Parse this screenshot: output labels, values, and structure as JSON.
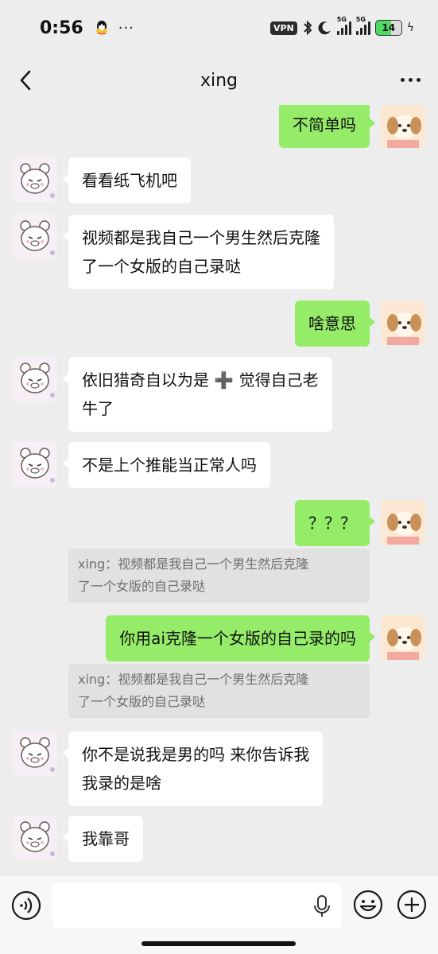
{
  "status_bar": {
    "time": "0:56",
    "more": "···",
    "vpn": "VPN",
    "sim1": "5G",
    "sim2": "5G",
    "battery": "14",
    "battery_color": "#4cd964"
  },
  "header": {
    "title": "xing"
  },
  "colors": {
    "outgoing_bubble": "#95ec69",
    "incoming_bubble": "#ffffff",
    "background": "#ededed"
  },
  "messages": [
    {
      "side": "out",
      "text": "不简单吗"
    },
    {
      "side": "in",
      "text": "看看纸飞机吧"
    },
    {
      "side": "in",
      "text": "视频都是我自己一个男生然后克隆\n了一个女版的自己录哒"
    },
    {
      "side": "out",
      "text": "啥意思"
    },
    {
      "side": "in",
      "text": "依旧猎奇自以为是 ➕ 觉得自己老\n牛了"
    },
    {
      "side": "in",
      "text": "不是上个推能当正常人吗"
    },
    {
      "side": "out",
      "text": "？？？",
      "quote": "xing：视频都是我自己一个男生然后克隆\n了一个女版的自己录哒"
    },
    {
      "side": "out",
      "text": "你用ai克隆一个女版的自己录的吗",
      "quote": "xing：视频都是我自己一个男生然后克隆\n了一个女版的自己录哒"
    },
    {
      "side": "in",
      "text": "你不是说我是男的吗 来你告诉我\n我录的是啥"
    },
    {
      "side": "in",
      "text": "我靠哥"
    }
  ],
  "input_bar": {
    "value": "",
    "icons": [
      "voice-icon",
      "microphone-icon",
      "emoji-icon",
      "plus-icon"
    ]
  }
}
